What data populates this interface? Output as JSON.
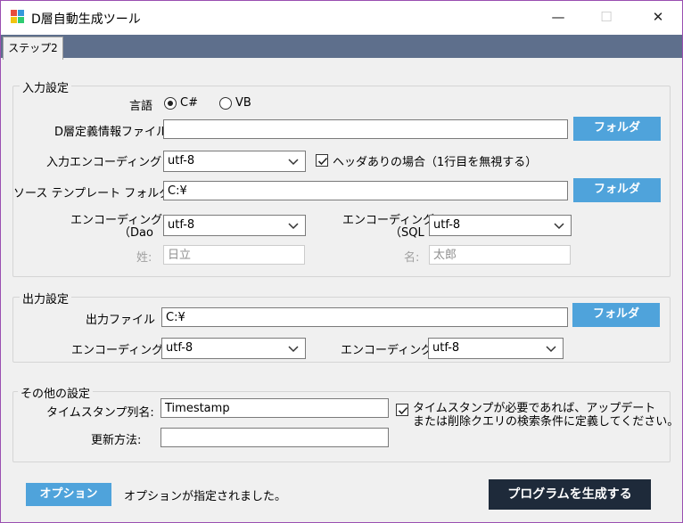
{
  "window": {
    "title": "D層自動生成ツール",
    "minimize": "—",
    "maximize": "☐",
    "close": "✕"
  },
  "tabs": [
    {
      "label": "ステップ2",
      "selected": true
    }
  ],
  "input_group": {
    "title": "入力設定",
    "language_label": "言語",
    "lang_options": [
      {
        "label": "C#",
        "selected": true
      },
      {
        "label": "VB",
        "selected": false
      }
    ],
    "def_file_label": "D層定義情報ファイル",
    "def_file_value": "",
    "folder_btn": "フォルダ",
    "encoding_label": "入力エンコーディング",
    "encoding_value": "utf-8",
    "header_check": "ヘッダありの場合（1行目を無視する）",
    "header_checked": true,
    "template_label": "ソース テンプレート フォルダ",
    "template_value": "C:¥",
    "enc_dao_label1": "エンコーディング",
    "enc_dao_label2": "（Dao",
    "enc_dao_value": "utf-8",
    "enc_sql_label1": "エンコーディング",
    "enc_sql_label2": "（SQL",
    "enc_sql_value": "utf-8",
    "last_name_label": "姓:",
    "last_name_value": "日立",
    "first_name_label": "名:",
    "first_name_value": "太郎"
  },
  "output_group": {
    "title": "出力設定",
    "file_label": "出力ファイル",
    "file_value": "C:¥",
    "folder_btn": "フォルダ",
    "enc1_label": "エンコーディング",
    "enc1_value": "utf-8",
    "enc2_label": "エンコーディング",
    "enc2_value": "utf-8"
  },
  "other_group": {
    "title": "その他の設定",
    "ts_label": "タイムスタンプ列名:",
    "ts_value": "Timestamp",
    "ts_check_line1": "タイムスタンプが必要であれば、アップデート",
    "ts_check_line2": "または削除クエリの検索条件に定義してください。",
    "ts_checked": true,
    "update_label": "更新方法:",
    "update_value": ""
  },
  "footer": {
    "option_btn": "オプション",
    "status": "オプションが指定されました。",
    "generate_btn": "プログラムを生成する"
  },
  "colors": {
    "accent": "#4fa3db",
    "dark_button": "#1e2a3a",
    "tab_strip": "#5e6f8c",
    "window_border": "#9a4fb1"
  },
  "icons": [
    "app-icon",
    "chevron-down-icon",
    "checkmark-icon"
  ]
}
